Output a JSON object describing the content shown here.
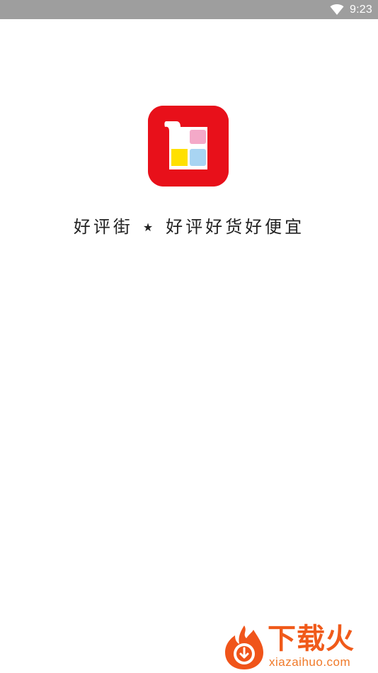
{
  "status_bar": {
    "time": "9:23",
    "icons": [
      "wifi-icon"
    ]
  },
  "splash": {
    "logo_icon": "app-logo-icon",
    "slogan_left": "好评街",
    "slogan_separator": "★",
    "slogan_right": "好评好货好便宜"
  },
  "watermark": {
    "title": "下载火",
    "url": "xiazaihuo.com",
    "icon": "flame-download-icon"
  },
  "colors": {
    "status_bar_bg": "#9e9e9e",
    "logo_red": "#e8101a",
    "logo_pink": "#f4a9c8",
    "logo_yellow": "#ffe000",
    "logo_blue": "#a8d4f2",
    "watermark_orange": "#f05a1a"
  }
}
